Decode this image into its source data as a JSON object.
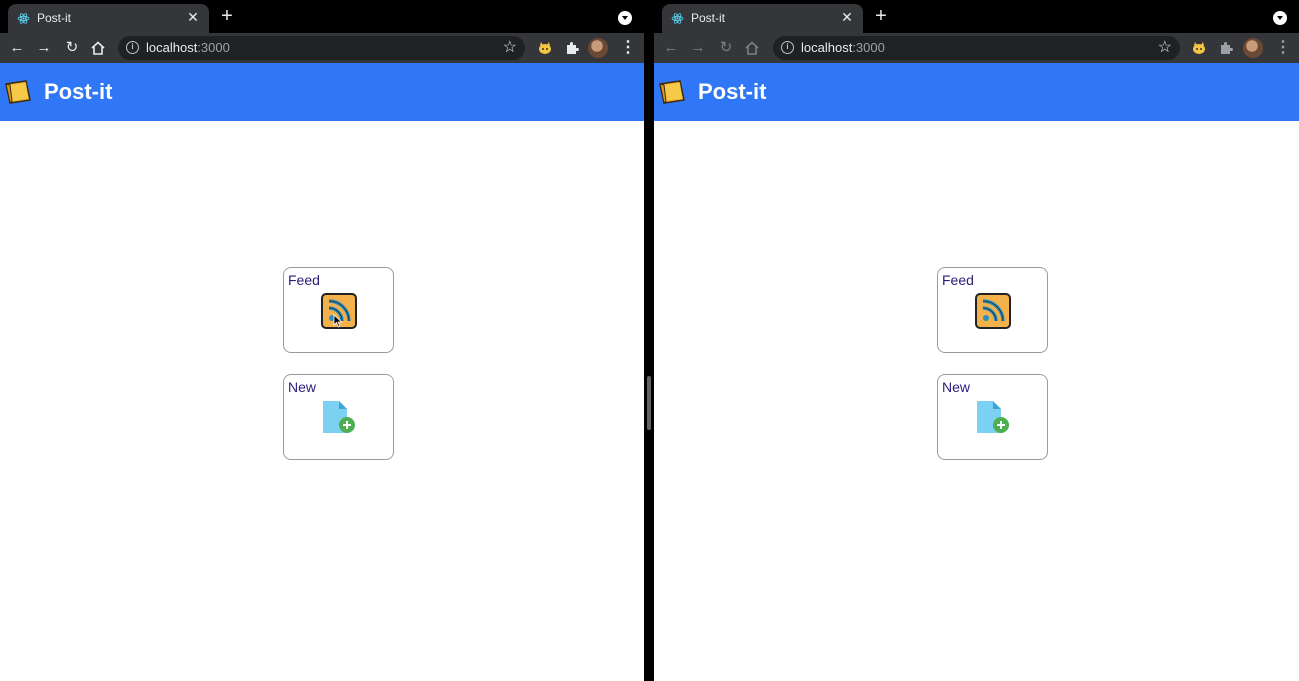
{
  "windows": [
    {
      "id": "left",
      "tab": {
        "title": "Post-it",
        "favicon": "react-icon"
      },
      "address": {
        "host": "localhost",
        "port": ":3000"
      },
      "app": {
        "title": "Post-it",
        "logo": "sticky-note-icon"
      },
      "cards": [
        {
          "label": "Feed",
          "icon": "rss-feed-icon"
        },
        {
          "label": "New",
          "icon": "new-document-icon"
        }
      ]
    },
    {
      "id": "right",
      "tab": {
        "title": "Post-it",
        "favicon": "react-icon"
      },
      "address": {
        "host": "localhost",
        "port": ":3000"
      },
      "app": {
        "title": "Post-it",
        "logo": "sticky-note-icon"
      },
      "cards": [
        {
          "label": "Feed",
          "icon": "rss-feed-icon"
        },
        {
          "label": "New",
          "icon": "new-document-icon"
        }
      ]
    }
  ],
  "colors": {
    "app_header": "#2f77f6",
    "card_label": "#2a1d7a",
    "browser_chrome": "#35363a"
  }
}
